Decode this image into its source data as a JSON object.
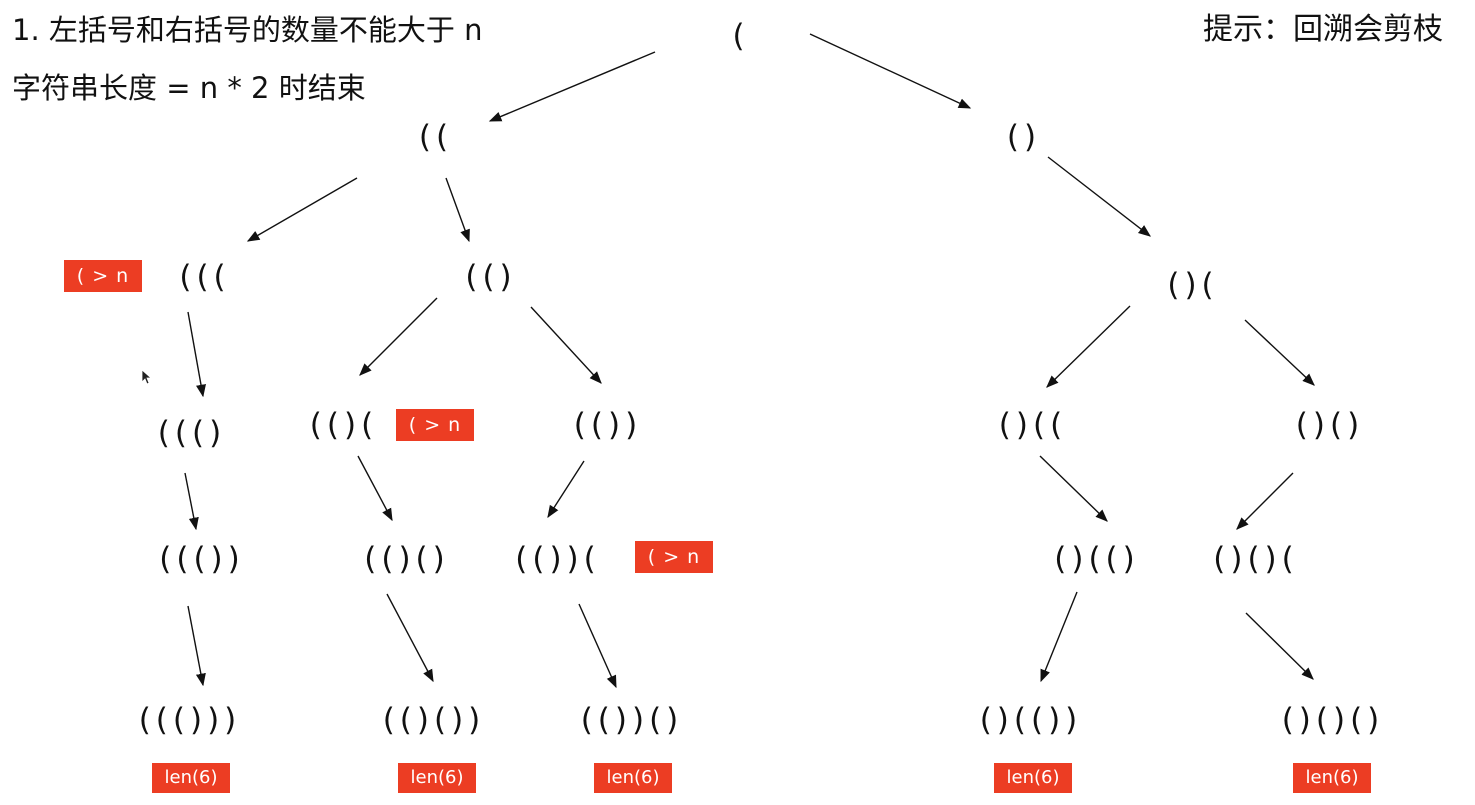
{
  "rules": {
    "line1": "1.  左括号和右括号的数量不能大于 n",
    "line2": "字符串长度 = n * 2 时结束"
  },
  "hint": "提示：回溯会剪枝",
  "nodes": {
    "root": "(",
    "l1_a": "((",
    "l1_b": "()",
    "l2_a": "(((",
    "l2_b": "(()",
    "l2_c": "()(",
    "l3_a": "((()",
    "l3_b": "(()(",
    "l3_c": "(())",
    "l3_d": "()((",
    "l3_e": "()()",
    "l4_a": "((())",
    "l4_b": "(()()",
    "l4_c": "(())(",
    "l4_d": "()(()",
    "l4_e": "()()(",
    "l5_a": "((()))",
    "l5_b": "(()())",
    "l5_c": "(())()",
    "l5_d": "()(())",
    "l5_e": "()()()"
  },
  "tags": {
    "prune": "( > n",
    "done": "len(6)"
  },
  "colors": {
    "tag_bg": "#ec3d23",
    "tag_text": "#ffffff",
    "edge": "#111111",
    "text": "#111111"
  },
  "icons": {
    "cursor": "mouse-pointer-icon"
  }
}
